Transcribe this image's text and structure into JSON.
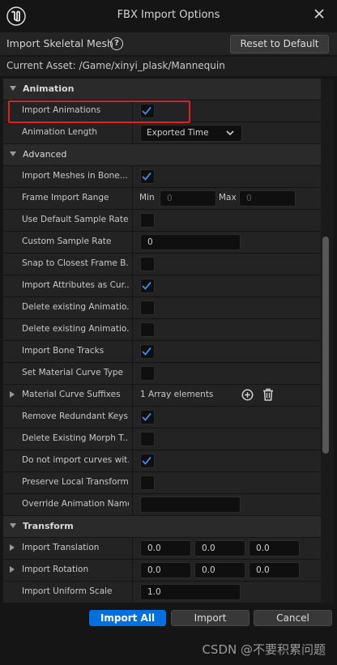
{
  "window": {
    "title": "FBX Import Options",
    "header_label": "Import Skeletal Mesh",
    "reset_label": "Reset to Default",
    "current_asset": "Current Asset:  /Game/xinyi_plask/Mannequin"
  },
  "sections": {
    "animation": "Animation",
    "advanced": "Advanced",
    "transform": "Transform"
  },
  "rows": {
    "import_animations": {
      "label": "Import Animations",
      "checked": true
    },
    "animation_length": {
      "label": "Animation Length",
      "value": "Exported Time"
    },
    "import_meshes_in_bone": {
      "label": "Import Meshes in Bone...",
      "checked": true
    },
    "frame_import_range": {
      "label": "Frame Import Range",
      "min_label": "Min",
      "min_value": "0",
      "max_label": "Max",
      "max_value": "0"
    },
    "use_default_sample_rate": {
      "label": "Use Default Sample Rate",
      "checked": false
    },
    "custom_sample_rate": {
      "label": "Custom Sample Rate",
      "value": "0"
    },
    "snap_to_closest_frame": {
      "label": "Snap to Closest Frame B...",
      "checked": false
    },
    "import_attributes_as_curves": {
      "label": "Import Attributes as Cur...",
      "checked": true
    },
    "delete_existing_animation_1": {
      "label": "Delete existing Animatio...",
      "checked": false
    },
    "delete_existing_animation_2": {
      "label": "Delete existing Animatio...",
      "checked": false
    },
    "import_bone_tracks": {
      "label": "Import Bone Tracks",
      "checked": true
    },
    "set_material_curve_type": {
      "label": "Set Material Curve Type",
      "checked": false
    },
    "material_curve_suffixes": {
      "label": "Material Curve Suffixes",
      "value": "1 Array elements"
    },
    "remove_redundant_keys": {
      "label": "Remove Redundant Keys",
      "checked": true
    },
    "delete_existing_morph_targets": {
      "label": "Delete Existing Morph T...",
      "checked": false
    },
    "do_not_import_curves": {
      "label": "Do not import curves wit...",
      "checked": true
    },
    "preserve_local_transform": {
      "label": "Preserve Local Transform",
      "checked": false
    },
    "override_animation_name": {
      "label": "Override Animation Name",
      "value": ""
    },
    "import_translation": {
      "label": "Import Translation",
      "x": "0.0",
      "y": "0.0",
      "z": "0.0"
    },
    "import_rotation": {
      "label": "Import Rotation",
      "x": "0.0",
      "y": "0.0",
      "z": "0.0"
    },
    "import_uniform_scale": {
      "label": "Import Uniform Scale",
      "value": "1.0"
    }
  },
  "footer": {
    "import_all": "Import All",
    "import": "Import",
    "cancel": "Cancel",
    "watermark": "CSDN @不要积累问题"
  },
  "colors": {
    "accent": "#0070e0",
    "check": "#3b8eea",
    "highlight": "#e02020"
  },
  "icons": {
    "logo": "unreal-engine-logo",
    "close": "close-icon",
    "help": "help-icon",
    "add": "plus-circle-icon",
    "delete": "trash-icon"
  }
}
